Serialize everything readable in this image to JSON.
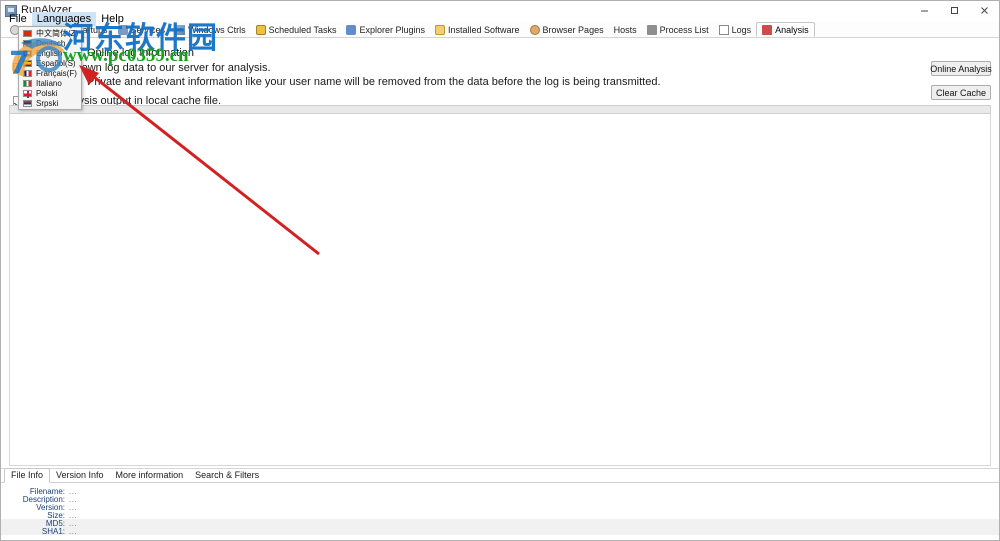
{
  "window": {
    "title": "RunAlyzer",
    "icon": "app-icon",
    "controls": {
      "minimize": "–",
      "maximize": "❐",
      "close": "✕"
    }
  },
  "menubar": {
    "items": [
      {
        "label": "File",
        "active": false
      },
      {
        "label": "Languages",
        "active": true
      },
      {
        "label": "Help",
        "active": false
      }
    ]
  },
  "languages_dropdown": {
    "items": [
      {
        "label": "中文简体(Z)",
        "flag": "f-zh"
      },
      {
        "label": "Deutsch",
        "flag": "f-de"
      },
      {
        "label": "English",
        "flag": "f-gb"
      },
      {
        "label": "Español(S)",
        "flag": "f-es"
      },
      {
        "label": "Français(F)",
        "flag": "f-fr"
      },
      {
        "label": "Italiano",
        "flag": "f-it"
      },
      {
        "label": "Polski",
        "flag": "f-pl"
      },
      {
        "label": "Srpski",
        "flag": "f-rs"
      }
    ]
  },
  "toolbar": {
    "items": [
      {
        "label": "History",
        "icon": "clock-icon",
        "iconClass": "ico-clock",
        "active": false
      },
      {
        "label": "Startups",
        "icon": "rocket-icon",
        "iconClass": "ico-rocket",
        "active": false
      },
      {
        "label": "Services",
        "icon": "gear-icon",
        "iconClass": "ico-gear",
        "active": false
      },
      {
        "label": "Windows Ctrls",
        "icon": "window-icon",
        "iconClass": "ico-win",
        "active": false
      },
      {
        "label": "Scheduled Tasks",
        "icon": "calendar-icon",
        "iconClass": "ico-cal",
        "active": false
      },
      {
        "label": "Explorer Plugins",
        "icon": "plugin-icon",
        "iconClass": "ico-plug",
        "active": false
      },
      {
        "label": "Installed Software",
        "icon": "folder-icon",
        "iconClass": "ico-folder",
        "active": false
      },
      {
        "label": "Browser Pages",
        "icon": "globe-icon",
        "iconClass": "ico-globe",
        "active": false
      },
      {
        "label": "Hosts",
        "icon": "",
        "iconClass": "",
        "active": false
      },
      {
        "label": "Process List",
        "icon": "cpu-icon",
        "iconClass": "ico-cpu",
        "active": false
      },
      {
        "label": "Logs",
        "icon": "document-icon",
        "iconClass": "ico-doc",
        "active": false
      },
      {
        "label": "Analysis",
        "icon": "chart-icon",
        "iconClass": "ico-chart",
        "active": true
      }
    ]
  },
  "analysis": {
    "heading": "Online log information",
    "option_send": {
      "checked": true,
      "label": "Send unknown log data to our server for analysis.",
      "note": "Private and relevant information like your user name will be removed from the data before the log is being transmitted."
    },
    "option_cache": {
      "checked": true,
      "label": "Keep analysis output in local cache file."
    },
    "buttons": {
      "online_analysis": "Online Analysis",
      "clear_cache": "Clear Cache"
    }
  },
  "bottom_panel": {
    "tabs": [
      {
        "label": "File Info",
        "active": true
      },
      {
        "label": "Version Info",
        "active": false
      },
      {
        "label": "More information",
        "active": false
      },
      {
        "label": "Search & Filters",
        "active": false
      }
    ],
    "file_info": [
      {
        "label": "Filename:",
        "value": "..."
      },
      {
        "label": "Description:",
        "value": "..."
      },
      {
        "label": "Version:",
        "value": "..."
      },
      {
        "label": "Size:",
        "value": "..."
      },
      {
        "label": "MD5:",
        "value": "..."
      },
      {
        "label": "SHA1:",
        "value": "..."
      }
    ]
  },
  "watermarks": {
    "chinese": "河东软件园",
    "url": "www.pc0359.cn",
    "chinese_color": "#1271c7",
    "url_color": "#16a01e",
    "arrow_color": "#d32020"
  }
}
